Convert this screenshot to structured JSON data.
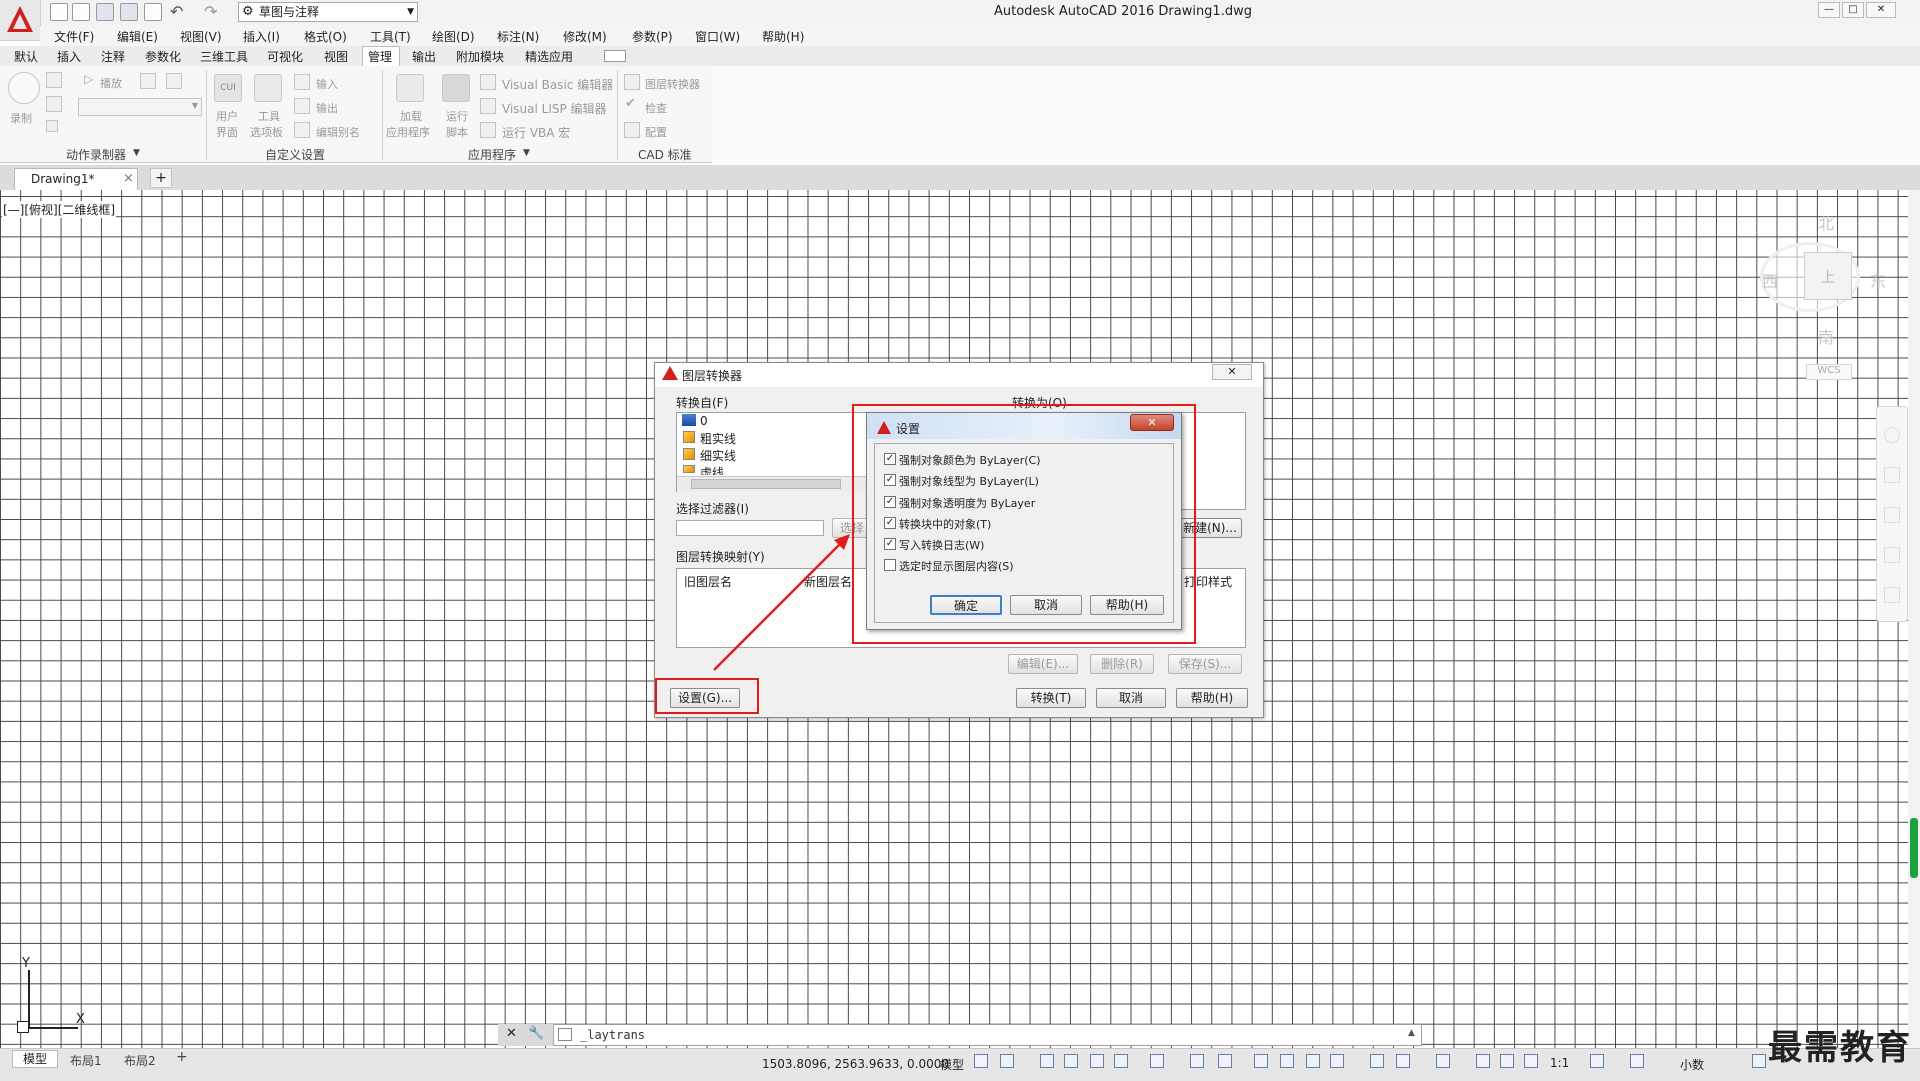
{
  "window": {
    "title": "Autodesk AutoCAD 2016    Drawing1.dwg",
    "workspace": "草图与注释",
    "controls": [
      "—",
      "□",
      "✕"
    ]
  },
  "menu": [
    "文件(F)",
    "编辑(E)",
    "视图(V)",
    "插入(I)",
    "格式(O)",
    "工具(T)",
    "绘图(D)",
    "标注(N)",
    "修改(M)",
    "参数(P)",
    "窗口(W)",
    "帮助(H)"
  ],
  "ribbon_tabs": [
    "默认",
    "插入",
    "注释",
    "参数化",
    "三维工具",
    "可视化",
    "视图",
    "管理",
    "输出",
    "附加模块",
    "精选应用"
  ],
  "ribbon": {
    "action_recorder": {
      "record": "录制",
      "play": "播放",
      "group": "动作录制器"
    },
    "customization": {
      "cui_line1": "用户",
      "cui_line2": "界面",
      "tool_line1": "工具",
      "tool_line2": "选项板",
      "import": "输入",
      "export": "输出",
      "edit_alias": "编辑别名",
      "group": "自定义设置"
    },
    "applications": {
      "load_line1": "加载",
      "load_line2": "应用程序",
      "run_line1": "运行",
      "run_line2": "脚本",
      "vb_editor": "Visual Basic 编辑器",
      "lisp_editor": "Visual LISP 编辑器",
      "run_vba": "运行 VBA 宏",
      "group": "应用程序"
    },
    "cad_standards": {
      "layer_translator": "图层转换器",
      "check": "检查",
      "configure": "配置",
      "group": "CAD 标准"
    }
  },
  "doc_tab": {
    "name": "Drawing1*",
    "close": "×",
    "new": "+"
  },
  "viewport": {
    "label": "[—][俯视][二维线框]"
  },
  "viewcube": {
    "north": "北",
    "south": "南",
    "east": "东",
    "west": "西",
    "top": "上",
    "wcs": "WCS"
  },
  "ucs": {
    "x": "X",
    "y": "Y"
  },
  "command_line": {
    "text": "_laytrans"
  },
  "layout_tabs": [
    "模型",
    "布局1",
    "布局2",
    "+"
  ],
  "status": {
    "coords": "1503.8096, 2563.9633, 0.0000",
    "mode": "模型",
    "scale": "1:1",
    "units": "小数"
  },
  "watermark": "最需教育",
  "layer_translator": {
    "title": "图层转换器",
    "translate_from": "转换自(F)",
    "translate_to": "转换为(O)",
    "from_layers": [
      "0",
      "粗实线",
      "细实线",
      "虚线"
    ],
    "selection_filter": "选择过滤器(I)",
    "select_button": "选择",
    "new_button": "新建(N)...",
    "mappings_label": "图层转换映射(Y)",
    "columns": [
      "旧图层名",
      "新图层名",
      "打印样式"
    ],
    "edit_button": "编辑(E)...",
    "delete_button": "删除(R)",
    "save_button": "保存(S)...",
    "settings_button": "设置(G)...",
    "translate_button": "转换(T)",
    "cancel_button": "取消",
    "help_button": "帮助(H)",
    "close": "✕"
  },
  "settings": {
    "title": "设置",
    "close": "✕",
    "options": [
      {
        "label": "强制对象颜色为 ByLayer(C)",
        "checked": true
      },
      {
        "label": "强制对象线型为 ByLayer(L)",
        "checked": true
      },
      {
        "label": "强制对象透明度为 ByLayer",
        "checked": true
      },
      {
        "label": "转换块中的对象(T)",
        "checked": true
      },
      {
        "label": "写入转换日志(W)",
        "checked": true
      },
      {
        "label": "选定时显示图层内容(S)",
        "checked": false
      }
    ],
    "ok": "确定",
    "cancel": "取消",
    "help": "帮助(H)"
  },
  "colors": {
    "annotation_red": "#e21b1b",
    "scroll_green": "#1aa33a",
    "autocad_red": "#d21f1f"
  }
}
